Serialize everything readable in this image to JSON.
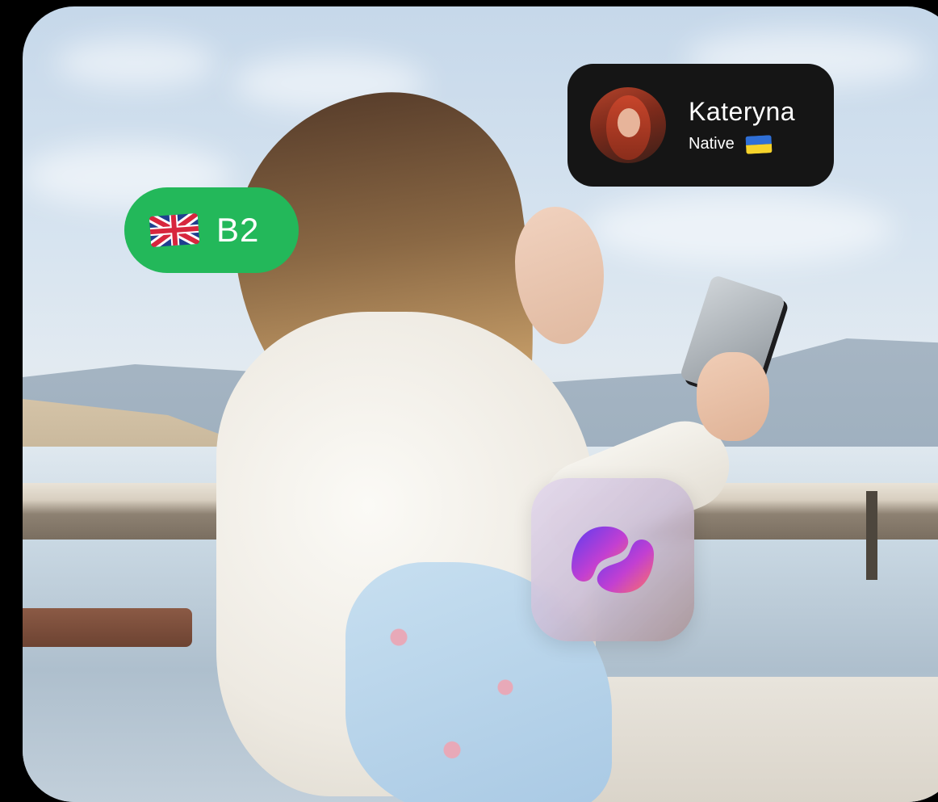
{
  "level_badge": {
    "flag_icon": "uk-flag-icon",
    "level": "B2",
    "color": "#23b85a"
  },
  "tutor_card": {
    "name": "Kateryna",
    "level_label": "Native",
    "flag_icon": "ukraine-flag-icon",
    "background": "#151515"
  },
  "app_icon": {
    "icon": "app-logo-icon",
    "gradient_colors": [
      "#5b3cf0",
      "#c23fd2",
      "#ff7262"
    ]
  }
}
